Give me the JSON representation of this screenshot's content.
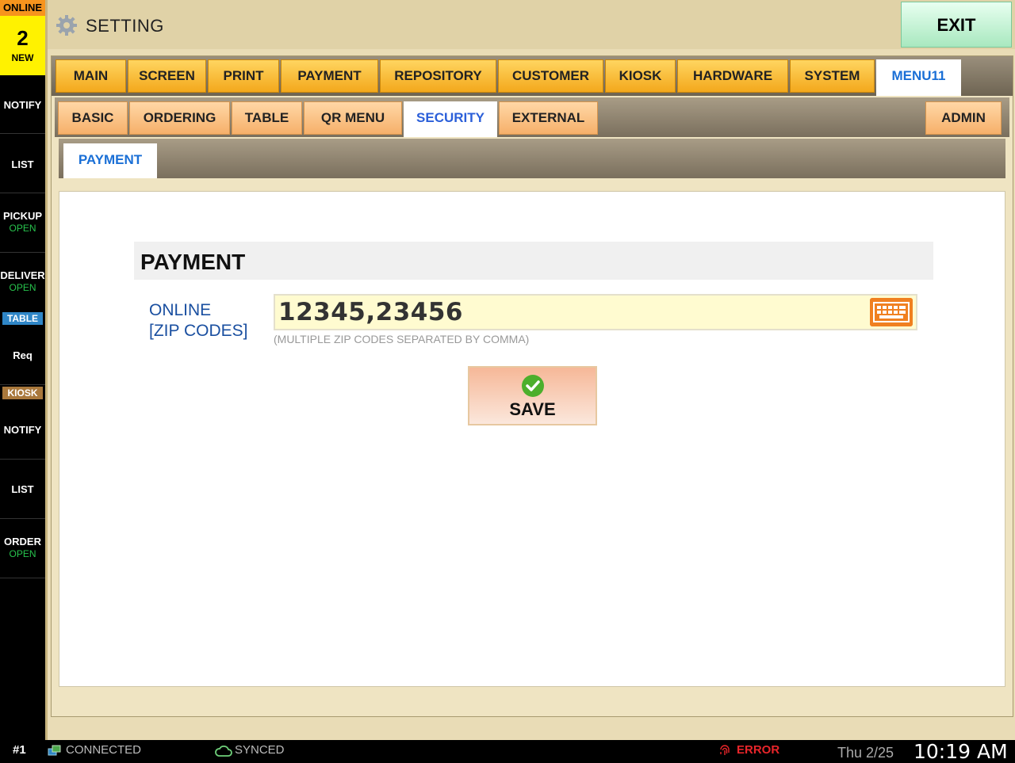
{
  "sidebar": {
    "online_header": "ONLINE",
    "online_count": "2",
    "online_new": "NEW",
    "online_items": [
      {
        "label": "NOTIFY",
        "sub": ""
      },
      {
        "label": "LIST",
        "sub": ""
      },
      {
        "label": "PICKUP",
        "sub": "OPEN"
      },
      {
        "label": "DELIVER",
        "sub": "OPEN"
      }
    ],
    "table_section": "TABLE",
    "table_items": [
      {
        "label": "Req",
        "sub": ""
      }
    ],
    "kiosk_section": "KIOSK",
    "kiosk_items": [
      {
        "label": "NOTIFY",
        "sub": ""
      },
      {
        "label": "LIST",
        "sub": ""
      },
      {
        "label": "ORDER",
        "sub": "OPEN"
      }
    ]
  },
  "header": {
    "title": "SETTING",
    "exit_label": "EXIT"
  },
  "main_tabs": [
    "MAIN",
    "SCREEN",
    "PRINT",
    "PAYMENT",
    "REPOSITORY",
    "CUSTOMER",
    "KIOSK",
    "HARDWARE",
    "SYSTEM",
    "MENU11"
  ],
  "main_tabs_active": "MENU11",
  "sub_tabs": [
    "BASIC",
    "ORDERING",
    "TABLE",
    "QR MENU",
    "SECURITY",
    "EXTERNAL"
  ],
  "sub_tabs_active": "SECURITY",
  "admin_tab": "ADMIN",
  "inner_tab": "PAYMENT",
  "form": {
    "section_title": "PAYMENT",
    "label_line1": "ONLINE",
    "label_line2": "[ZIP CODES]",
    "value": "12345,23456",
    "hint": "(MULTIPLE ZIP CODES SEPARATED BY COMMA)",
    "save_label": "SAVE"
  },
  "status": {
    "terminal": "#1",
    "connection": "CONNECTED",
    "sync": "SYNCED",
    "error": "ERROR",
    "date": "Thu 2/25",
    "time": "10:19 AM"
  },
  "colors": {
    "accent_tab": "#f3a81c",
    "active_text": "#1a6fd6",
    "online_header": "#f7941d",
    "online_box": "#fff200",
    "open_green": "#27c24c",
    "error_red": "#e8252a",
    "table_section": "#2f86c7",
    "kiosk_section": "#a9783c"
  }
}
